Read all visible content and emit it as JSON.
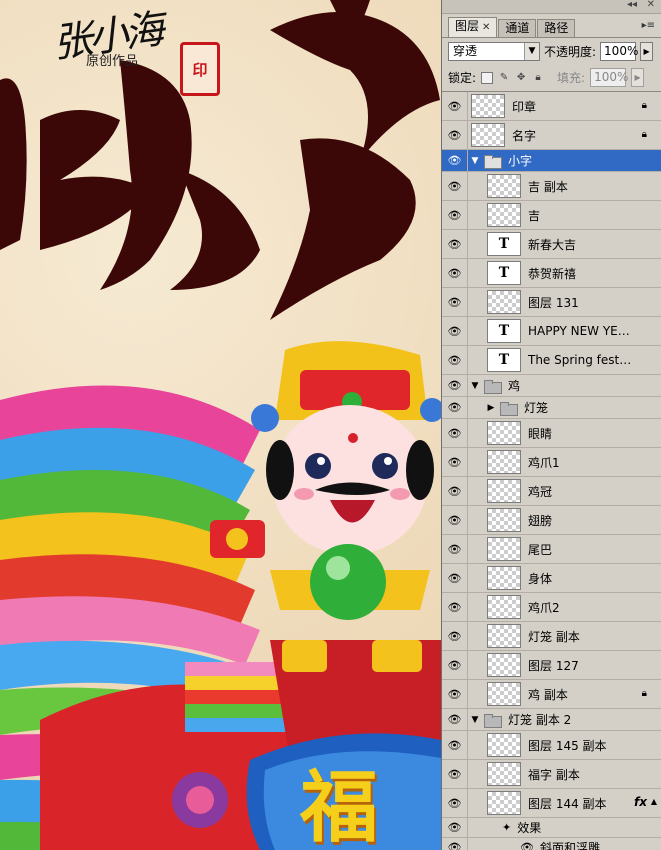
{
  "artwork": {
    "signature": "张小海",
    "subtitle": "原创作品",
    "seal_text": "印",
    "calligraphy_1": "鸡",
    "calligraphy_2": "年",
    "calligraphy_3": "贺",
    "fu_char": "福"
  },
  "panel": {
    "tabs": [
      {
        "label": "图层",
        "close": "✕"
      },
      {
        "label": "通道"
      },
      {
        "label": "路径"
      }
    ],
    "blend_mode": "穿透",
    "opacity_label": "不透明度:",
    "opacity_value": "100%",
    "lock_label": "锁定:",
    "fill_label": "填充:",
    "fill_value": "100%"
  },
  "layers": [
    {
      "name": "印章",
      "kind": "pixel",
      "locked": true
    },
    {
      "name": "名字",
      "kind": "pixel",
      "locked": true
    },
    {
      "name": "小字",
      "kind": "group",
      "expanded": true,
      "selected": true
    },
    {
      "name": "吉 副本",
      "kind": "pixel",
      "depth": 1
    },
    {
      "name": "吉",
      "kind": "pixel",
      "depth": 1
    },
    {
      "name": "新春大吉",
      "kind": "text",
      "depth": 1
    },
    {
      "name": "恭贺新禧",
      "kind": "text",
      "depth": 1
    },
    {
      "name": "图层 131",
      "kind": "pixel",
      "depth": 1
    },
    {
      "name": "HAPPY NEW YEAR",
      "kind": "text",
      "depth": 1
    },
    {
      "name": "The Spring festival...",
      "kind": "text",
      "depth": 1
    },
    {
      "name": "鸡",
      "kind": "group",
      "expanded": true
    },
    {
      "name": "灯笼",
      "kind": "group",
      "expanded": false,
      "depth": 1
    },
    {
      "name": "眼睛",
      "kind": "pixel",
      "depth": 1
    },
    {
      "name": "鸡爪1",
      "kind": "pixel",
      "depth": 1
    },
    {
      "name": "鸡冠",
      "kind": "pixel",
      "depth": 1
    },
    {
      "name": "翅膀",
      "kind": "pixel",
      "depth": 1
    },
    {
      "name": "尾巴",
      "kind": "pixel",
      "depth": 1
    },
    {
      "name": "身体",
      "kind": "pixel",
      "depth": 1
    },
    {
      "name": "鸡爪2",
      "kind": "pixel",
      "depth": 1
    },
    {
      "name": "灯笼 副本",
      "kind": "pixel",
      "depth": 1
    },
    {
      "name": "图层 127",
      "kind": "pixel",
      "depth": 1
    },
    {
      "name": "鸡 副本",
      "kind": "pixel",
      "depth": 1,
      "locked": true
    },
    {
      "name": "灯笼 副本 2",
      "kind": "group",
      "expanded": true
    },
    {
      "name": "图层 145 副本",
      "kind": "pixel",
      "depth": 1
    },
    {
      "name": "福字 副本",
      "kind": "pixel",
      "depth": 1
    },
    {
      "name": "图层 144 副本",
      "kind": "pixel",
      "depth": 1,
      "fx": "fx"
    }
  ],
  "effects": {
    "label": "效果",
    "item": "斜面和浮雕"
  },
  "colors": {
    "panel_bg": "#d4d0c8",
    "selection": "#316ac5",
    "calligraphy": "#3a0505",
    "seal_red": "#c8171c"
  }
}
